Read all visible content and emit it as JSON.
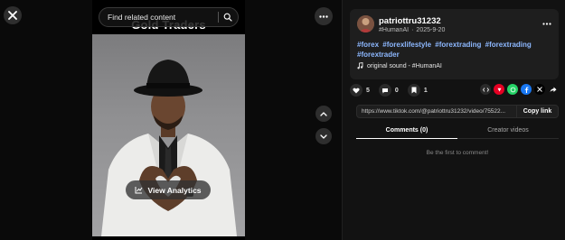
{
  "player": {
    "search_placeholder": "Find related content",
    "video_title": "Gold Traders",
    "view_analytics_label": "View Analytics"
  },
  "post": {
    "username": "patriottru31232",
    "nickname": "#HumanAI",
    "date": "2025-9-20",
    "hashtags": [
      "#forex",
      "#forexlifestyle",
      "#forextrading",
      "#forextrading",
      "#forextrader"
    ],
    "sound": "original sound - #HumanAI"
  },
  "actions": {
    "likes": "5",
    "comments": "0",
    "saves": "1"
  },
  "share": {
    "icons": [
      "embed-icon",
      "pinterest-icon",
      "whatsapp-icon",
      "facebook-icon",
      "x-icon",
      "forward-icon"
    ],
    "colors": {
      "pinterest": "#e60023",
      "whatsapp": "#25d366",
      "facebook": "#1877f2"
    }
  },
  "link": {
    "url": "https://www.tiktok.com/@patriottru31232/video/75522...",
    "copy_label": "Copy link"
  },
  "tabs": [
    {
      "label": "Comments (0)",
      "active": true
    },
    {
      "label": "Creator videos",
      "active": false
    }
  ],
  "comments": {
    "empty_message": "Be the first to comment!"
  },
  "theme": {
    "hashtag_color": "#8db8ff",
    "panel_bg": "#121212",
    "card_bg": "#1e1e1e"
  }
}
